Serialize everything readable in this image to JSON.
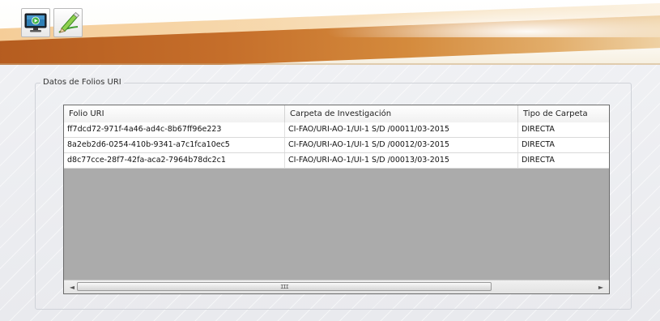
{
  "toolbar": {
    "buttons": [
      {
        "icon": "monitor-play-icon"
      },
      {
        "icon": "pen-edit-icon"
      }
    ]
  },
  "groupbox": {
    "title": "Datos de Folios URI"
  },
  "grid": {
    "columns": [
      "Folio URI",
      "Carpeta de Investigación",
      "Tipo de Carpeta"
    ],
    "rows": [
      [
        "ff7dcd72-971f-4a46-ad4c-8b67ff96e223",
        "CI-FAO/URI-AO-1/UI-1 S/D /00011/03-2015",
        "DIRECTA"
      ],
      [
        "8a2eb2d6-0254-410b-9341-a7c1fca10ec5",
        "CI-FAO/URI-AO-1/UI-1 S/D /00012/03-2015",
        "DIRECTA"
      ],
      [
        "d8c77cce-28f7-42fa-aca2-7964b78dc2c1",
        "CI-FAO/URI-AO-1/UI-1 S/D /00013/03-2015",
        "DIRECTA"
      ]
    ],
    "scroll": {
      "left_arrow": "◄",
      "right_arrow": "►",
      "grip": "III"
    }
  },
  "colors": {
    "grid_empty_area": "#ababab",
    "header_swoosh": "#c56e2a"
  }
}
